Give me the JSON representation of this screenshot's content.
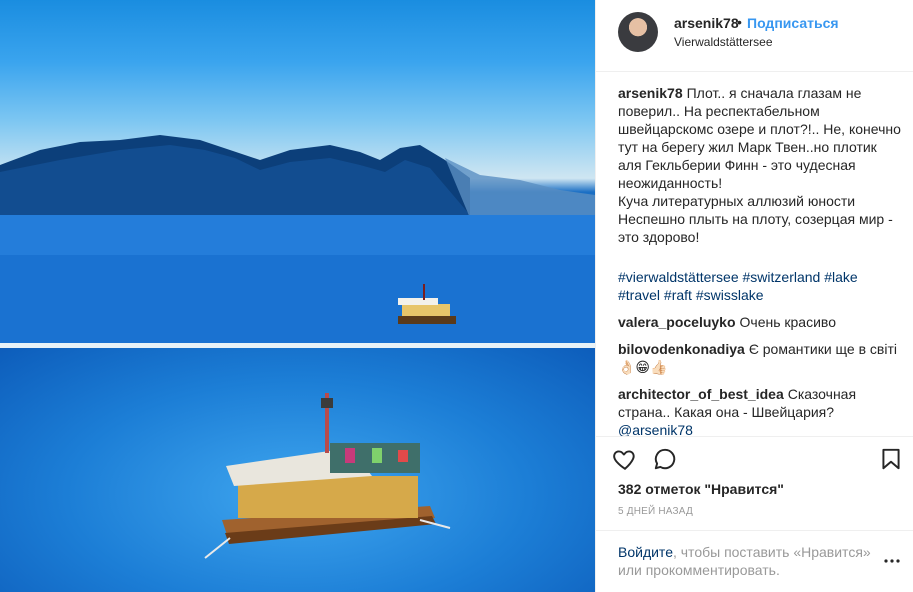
{
  "post": {
    "author": {
      "username": "arsenik78",
      "follow_label": "Подписаться",
      "dot": "•",
      "location": "Vierwaldstättersee"
    },
    "caption": {
      "username": "arsenik78",
      "text": "Плот.. я сначала глазам не поверил.. На респектабельном швейцарскомс⁣ озере и плот?!.. Не, конечно тут на берегу жил Марк Твен..но плотик аля Гекльберии Финн - это чудесная неожиданность!\nКуча литературных аллюзий юности ⁣⁣⁣\nНеспешно плыть на плоту, созерцая мир - это здорово!",
      "hashtags": [
        "#vierwaldstättersee",
        "#switzerland",
        "#lake",
        "#travel",
        "#raft",
        "#swisslake"
      ]
    },
    "comments": [
      {
        "username": "valera_poceluyko",
        "text": "Очень красиво"
      },
      {
        "username": "bilovodenkonadiya",
        "text": "Є романтики ще в світі 👌🏻😁👍🏻"
      },
      {
        "username": "architector_of_best_idea",
        "text": "Сказочная страна..⁣⁣ Какая она - Швейцария?",
        "mention": "@arsenik78"
      }
    ],
    "likes_label": "382 отметок \"Нравится\"",
    "time_label": "5 ДНЕЙ НАЗАД",
    "login": {
      "link": "Войдите",
      "rest": ", чтобы поставить «Нравится» или прокомментировать."
    },
    "icons": [
      "heart-icon",
      "comment-icon",
      "bookmark-icon",
      "more-options-icon"
    ]
  }
}
